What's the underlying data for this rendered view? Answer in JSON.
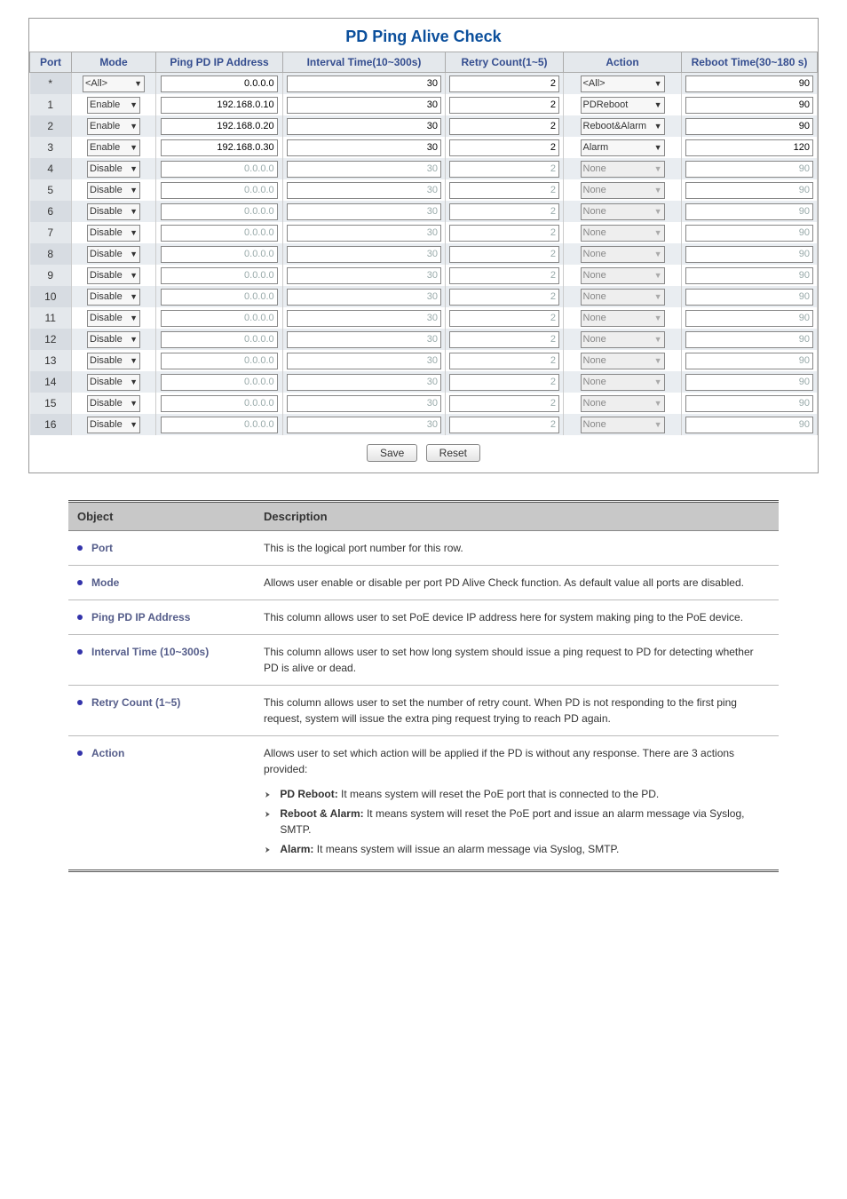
{
  "page": {
    "title": "PD Ping Alive Check"
  },
  "columns": {
    "port": "Port",
    "mode": "Mode",
    "ip": "Ping PD IP Address",
    "interval": "Interval Time(10~300s)",
    "retry": "Retry Count(1~5)",
    "action": "Action",
    "reboot": "Reboot Time(30~180 s)"
  },
  "header_row": {
    "port": "*",
    "mode": "<All>",
    "ip": "0.0.0.0",
    "interval": "30",
    "retry": "2",
    "action": "<All>",
    "reboot": "90"
  },
  "rows": [
    {
      "port": "1",
      "mode": "Enable",
      "ip": "192.168.0.10",
      "interval": "30",
      "retry": "2",
      "action": "PDReboot",
      "reboot": "90",
      "disabled": false
    },
    {
      "port": "2",
      "mode": "Enable",
      "ip": "192.168.0.20",
      "interval": "30",
      "retry": "2",
      "action": "Reboot&Alarm",
      "reboot": "90",
      "disabled": false
    },
    {
      "port": "3",
      "mode": "Enable",
      "ip": "192.168.0.30",
      "interval": "30",
      "retry": "2",
      "action": "Alarm",
      "reboot": "120",
      "disabled": false
    },
    {
      "port": "4",
      "mode": "Disable",
      "ip": "0.0.0.0",
      "interval": "30",
      "retry": "2",
      "action": "None",
      "reboot": "90",
      "disabled": true
    },
    {
      "port": "5",
      "mode": "Disable",
      "ip": "0.0.0.0",
      "interval": "30",
      "retry": "2",
      "action": "None",
      "reboot": "90",
      "disabled": true
    },
    {
      "port": "6",
      "mode": "Disable",
      "ip": "0.0.0.0",
      "interval": "30",
      "retry": "2",
      "action": "None",
      "reboot": "90",
      "disabled": true
    },
    {
      "port": "7",
      "mode": "Disable",
      "ip": "0.0.0.0",
      "interval": "30",
      "retry": "2",
      "action": "None",
      "reboot": "90",
      "disabled": true
    },
    {
      "port": "8",
      "mode": "Disable",
      "ip": "0.0.0.0",
      "interval": "30",
      "retry": "2",
      "action": "None",
      "reboot": "90",
      "disabled": true
    },
    {
      "port": "9",
      "mode": "Disable",
      "ip": "0.0.0.0",
      "interval": "30",
      "retry": "2",
      "action": "None",
      "reboot": "90",
      "disabled": true
    },
    {
      "port": "10",
      "mode": "Disable",
      "ip": "0.0.0.0",
      "interval": "30",
      "retry": "2",
      "action": "None",
      "reboot": "90",
      "disabled": true
    },
    {
      "port": "11",
      "mode": "Disable",
      "ip": "0.0.0.0",
      "interval": "30",
      "retry": "2",
      "action": "None",
      "reboot": "90",
      "disabled": true
    },
    {
      "port": "12",
      "mode": "Disable",
      "ip": "0.0.0.0",
      "interval": "30",
      "retry": "2",
      "action": "None",
      "reboot": "90",
      "disabled": true
    },
    {
      "port": "13",
      "mode": "Disable",
      "ip": "0.0.0.0",
      "interval": "30",
      "retry": "2",
      "action": "None",
      "reboot": "90",
      "disabled": true
    },
    {
      "port": "14",
      "mode": "Disable",
      "ip": "0.0.0.0",
      "interval": "30",
      "retry": "2",
      "action": "None",
      "reboot": "90",
      "disabled": true
    },
    {
      "port": "15",
      "mode": "Disable",
      "ip": "0.0.0.0",
      "interval": "30",
      "retry": "2",
      "action": "None",
      "reboot": "90",
      "disabled": true
    },
    {
      "port": "16",
      "mode": "Disable",
      "ip": "0.0.0.0",
      "interval": "30",
      "retry": "2",
      "action": "None",
      "reboot": "90",
      "disabled": true
    }
  ],
  "buttons": {
    "save": "Save",
    "reset": "Reset"
  },
  "desc": {
    "head_obj": "Object",
    "head_desc": "Description",
    "items": [
      {
        "obj": "Port",
        "desc": "This is the logical port number for this row."
      },
      {
        "obj": "Mode",
        "desc": "Allows user enable or disable per port PD Alive Check function. As default value all ports are disabled."
      },
      {
        "obj": "Ping PD IP Address",
        "desc": "This column allows user to set PoE device IP address here for system making ping to the PoE device."
      },
      {
        "obj": "Interval Time (10~300s)",
        "desc": "This column allows user to set how long system should issue a ping request to PD for detecting whether PD is alive or dead."
      },
      {
        "obj": "Retry Count (1~5)",
        "desc": "This column allows user to set the number of retry count. When PD is not responding to the first ping request, system will issue the extra ping request trying to reach PD again."
      }
    ],
    "action_obj": "Action",
    "action_lead": "Allows user to set which action will be applied if the PD is without any response. There are 3 actions provided:",
    "action_items": [
      {
        "label": "PD Reboot:",
        "text": "It means system will reset the PoE port that is connected to the PD."
      },
      {
        "label": "Reboot & Alarm:",
        "text": "It means system will reset the PoE port and issue an alarm message via Syslog, SMTP."
      },
      {
        "label": "Alarm:",
        "text": "It means system will issue an alarm message via Syslog, SMTP."
      }
    ]
  }
}
